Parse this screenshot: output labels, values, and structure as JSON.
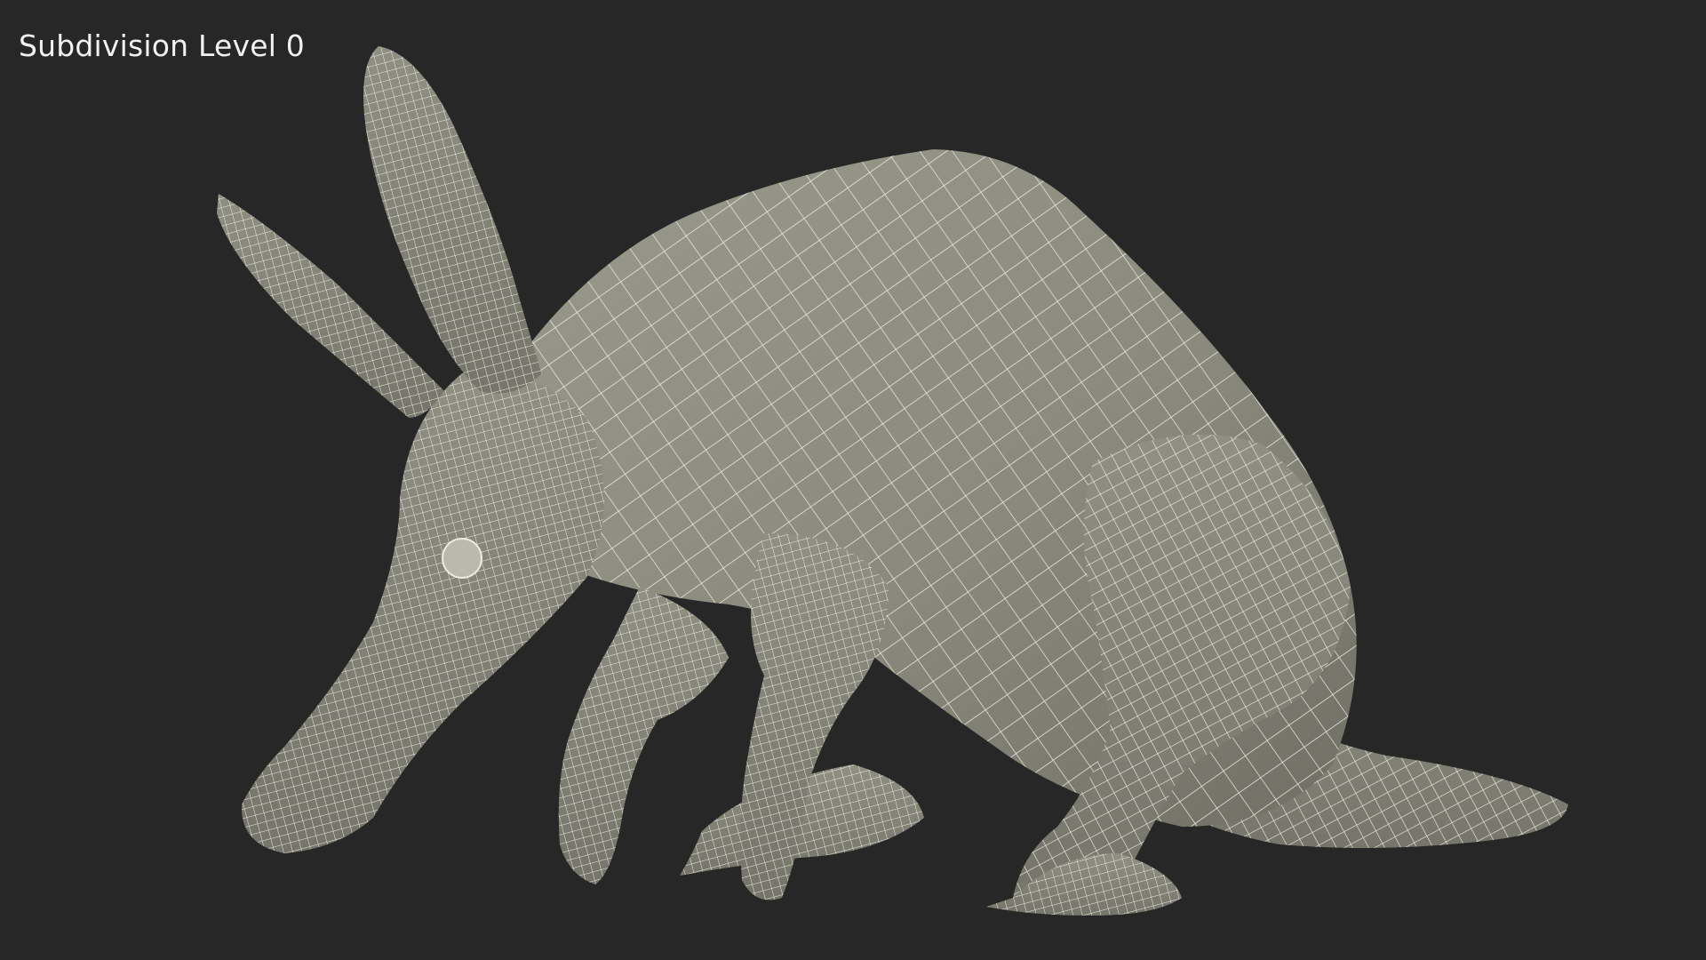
{
  "viewport": {
    "caption": "Subdivision Level 0",
    "background_color": "#272727",
    "mesh_fill_color": "#8d8d80",
    "wire_color": "#e9e9dc"
  },
  "model": {
    "subject": "aardvark wireframe mesh",
    "parts_icon_names": [
      "ear-left",
      "ear-right",
      "head-snout",
      "torso",
      "front-leg-left",
      "front-leg-right",
      "hind-leg",
      "tail"
    ]
  }
}
